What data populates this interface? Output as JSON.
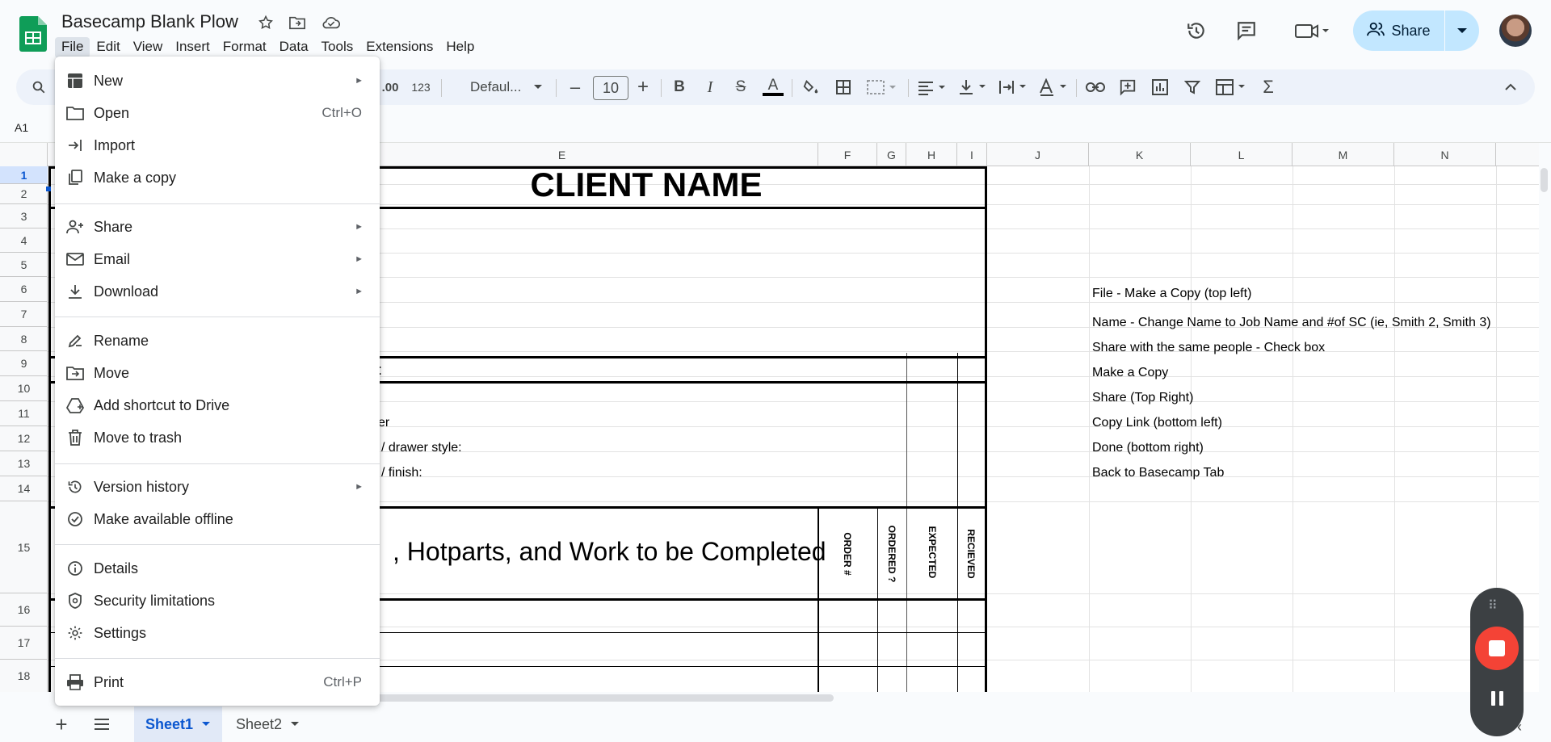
{
  "doc": {
    "title": "Basecamp Blank Plow",
    "share_label": "Share"
  },
  "menubar": [
    "File",
    "Edit",
    "View",
    "Insert",
    "Format",
    "Data",
    "Tools",
    "Extensions",
    "Help"
  ],
  "toolbar": {
    "number_format_label": "123",
    "decimal_label": ".00",
    "font": "Defaul...",
    "font_size": "10"
  },
  "namebox": "A1",
  "columns": [
    "E",
    "F",
    "G",
    "H",
    "I",
    "J",
    "K",
    "L",
    "M",
    "N"
  ],
  "rows": [
    "1",
    "2",
    "3",
    "4",
    "5",
    "6",
    "7",
    "8",
    "9",
    "10",
    "11",
    "12",
    "13",
    "14",
    "15",
    "16",
    "17",
    "18"
  ],
  "sheet": {
    "client_name": "CLIENT NAME",
    "row9_fragment": ":",
    "row11_fragment": "er",
    "row12_fragment": "/ drawer style:",
    "row13_fragment": "/ finish:",
    "parts_heading": ", Hotparts, and Work to be Completed",
    "vertical_headers": [
      "ORDER #",
      "ORDERED ?",
      "EXPECTED",
      "RECIEVED"
    ],
    "instructions": [
      "File - Make a Copy (top left)",
      "Name - Change Name to Job Name and #of SC (ie, Smith 2, Smith 3)",
      "Share with the same people - Check box",
      "Make a Copy",
      "Share (Top Right)",
      "Copy Link (bottom left)",
      "Done (bottom right)",
      "Back to Basecamp Tab"
    ]
  },
  "tabs": [
    "Sheet1",
    "Sheet2"
  ],
  "file_menu": [
    {
      "label": "New",
      "icon": "new-sheet-icon",
      "submenu": true
    },
    {
      "label": "Open",
      "icon": "folder-icon",
      "shortcut": "Ctrl+O"
    },
    {
      "label": "Import",
      "icon": "import-icon"
    },
    {
      "label": "Make a copy",
      "icon": "copy-icon"
    },
    {
      "label": "Share",
      "icon": "share-person-icon",
      "submenu": true
    },
    {
      "label": "Email",
      "icon": "email-icon",
      "submenu": true
    },
    {
      "label": "Download",
      "icon": "download-icon",
      "submenu": true
    },
    {
      "label": "Rename",
      "icon": "rename-icon"
    },
    {
      "label": "Move",
      "icon": "move-folder-icon"
    },
    {
      "label": "Add shortcut to Drive",
      "icon": "drive-shortcut-icon"
    },
    {
      "label": "Move to trash",
      "icon": "trash-icon"
    },
    {
      "label": "Version history",
      "icon": "history-icon",
      "submenu": true
    },
    {
      "label": "Make available offline",
      "icon": "offline-icon"
    },
    {
      "label": "Details",
      "icon": "info-icon"
    },
    {
      "label": "Security limitations",
      "icon": "shield-icon"
    },
    {
      "label": "Settings",
      "icon": "gear-icon"
    },
    {
      "label": "Print",
      "icon": "print-icon",
      "shortcut": "Ctrl+P"
    }
  ],
  "colors": {
    "accent": "#0b57d0",
    "share_bg": "#c2e7ff",
    "record_red": "#f44336",
    "sheets_green": "#0f9d58"
  }
}
